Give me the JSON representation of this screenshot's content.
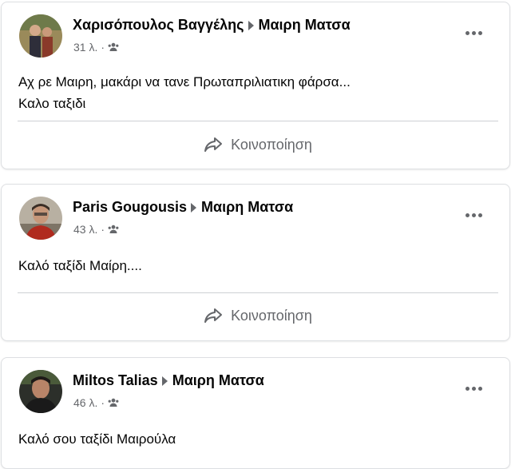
{
  "posts": [
    {
      "author": "Χαρισόπουλος Βαγγέλης",
      "target": "Μαιρη Ματσα",
      "time": "31 λ.",
      "separator": "·",
      "text_lines": [
        "Αχ ρε Μαιρη, μακάρι να τανε Πρωταπριλιατικη φάρσα...",
        "Καλο ταξιδι"
      ],
      "share_label": "Κοινοποίηση"
    },
    {
      "author": "Paris Gougousis",
      "target": "Μαιρη Ματσα",
      "time": "43 λ.",
      "separator": "·",
      "text_lines": [
        "Καλό ταξίδι Μαίρη...."
      ],
      "share_label": "Κοινοποίηση"
    },
    {
      "author": "Miltos Talias",
      "target": "Μαιρη Ματσα",
      "time": "46 λ.",
      "separator": "·",
      "text_lines": [
        "Καλό σου ταξίδι Μαιρούλα"
      ]
    }
  ],
  "icons": {
    "audience": "group-audience-icon",
    "more": "more-options-icon",
    "share": "share-arrow-icon",
    "arrow": "arrow-right-icon"
  },
  "colors": {
    "text_primary": "#050505",
    "text_secondary": "#65676b",
    "border": "#dddfe2",
    "divider": "#ced0d4"
  }
}
